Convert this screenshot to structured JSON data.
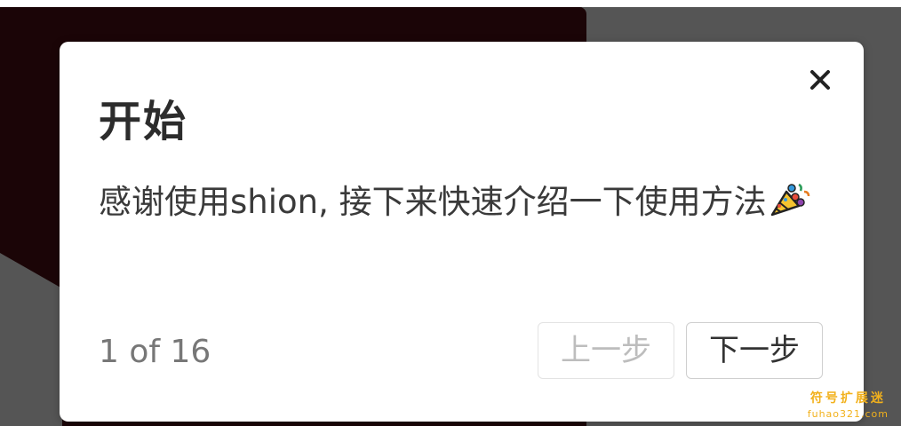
{
  "tour": {
    "title": "开始",
    "description": "感谢使用shion, 接下来快速介绍一下使用方法",
    "description_icon": "party-popper-icon",
    "progress": "1 of 16",
    "prev_label": "上一步",
    "next_label": "下一步",
    "close_icon": "close-icon"
  },
  "watermark": {
    "title": "符号扩展迷",
    "url": "fuhao321.com"
  },
  "colors": {
    "card_background": "#ffffff",
    "backdrop_dark": "#1b0507",
    "backdrop_gray": "#555555",
    "watermark": "#f2b11c"
  }
}
